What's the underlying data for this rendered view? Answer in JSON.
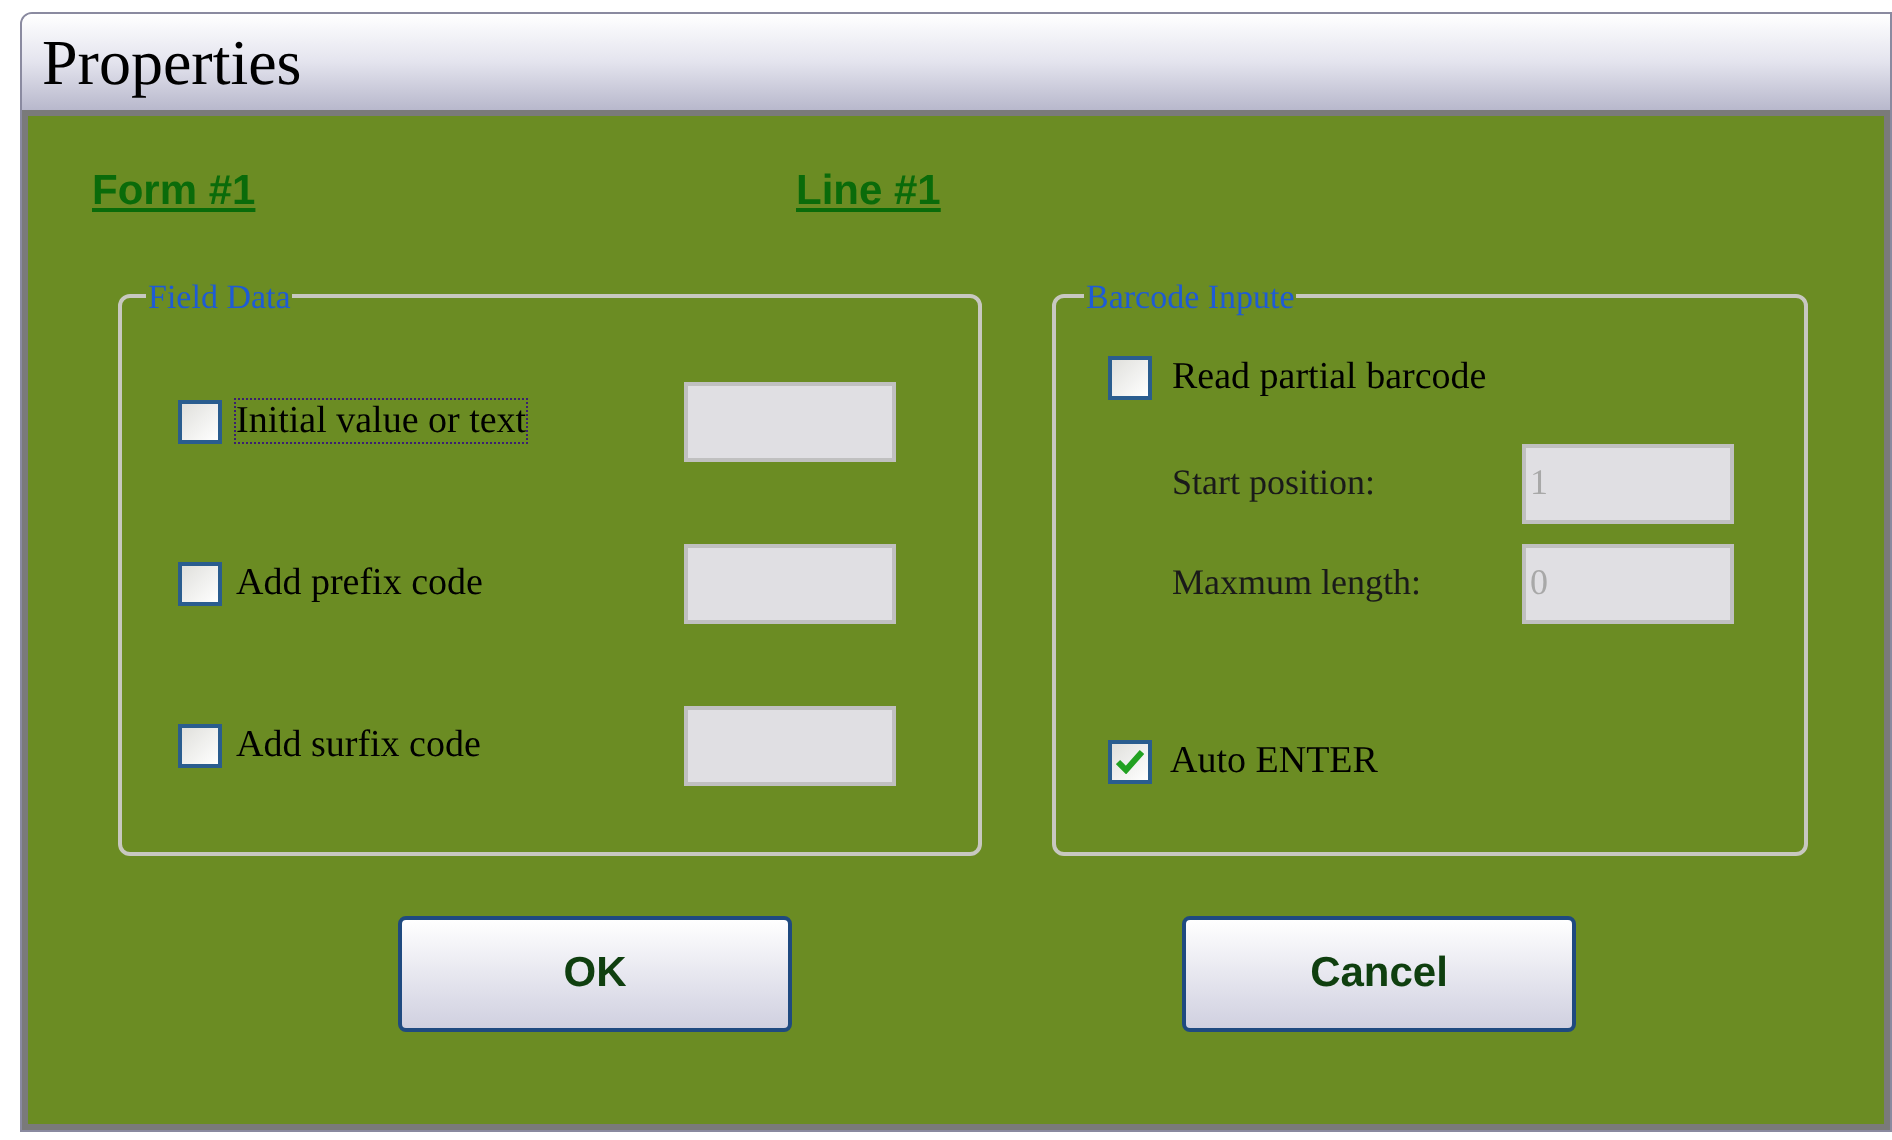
{
  "window": {
    "title": "Properties"
  },
  "header": {
    "form": "Form #1",
    "line": "Line #1"
  },
  "field_data": {
    "legend": "Field Data",
    "rows": [
      {
        "label": "Initial value or text",
        "checked": false,
        "focused": true
      },
      {
        "label": "Add prefix code",
        "checked": false,
        "focused": false
      },
      {
        "label": "Add surfix code",
        "checked": false,
        "focused": false
      }
    ]
  },
  "barcode_input": {
    "legend": "Barcode Inpute",
    "read_partial": {
      "label": "Read partial barcode",
      "checked": false
    },
    "fields": [
      {
        "label": "Start position:",
        "value": "1",
        "disabled": true
      },
      {
        "label": "Maxmum length:",
        "value": "0",
        "disabled": true
      }
    ],
    "auto_enter": {
      "label": "Auto ENTER",
      "checked": true
    }
  },
  "buttons": [
    {
      "label": "OK"
    },
    {
      "label": "Cancel"
    }
  ]
}
